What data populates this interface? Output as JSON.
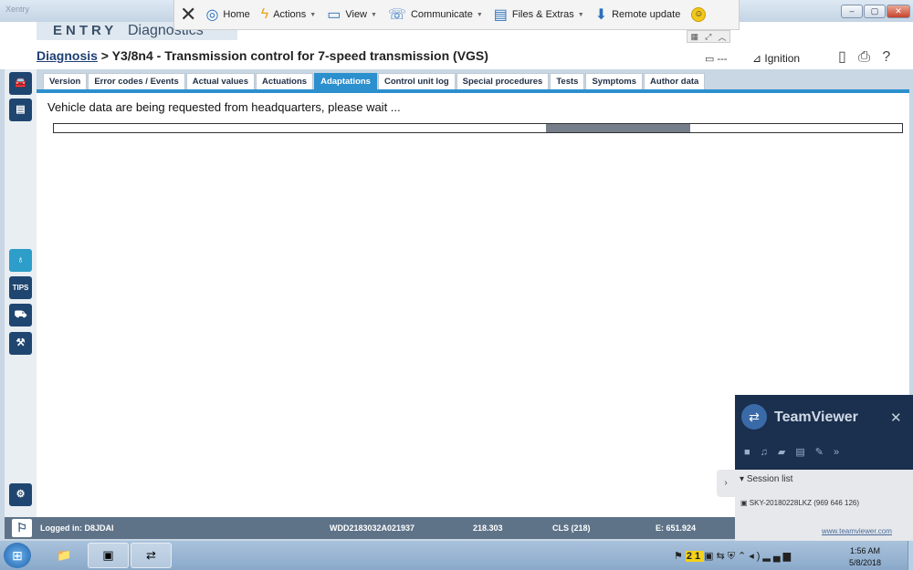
{
  "window": {
    "title": "Xentry"
  },
  "teamviewer_toolbar": {
    "home": "Home",
    "actions": "Actions",
    "view": "View",
    "communicate": "Communicate",
    "files": "Files & Extras",
    "remote_update": "Remote update"
  },
  "header": {
    "brand_entry": "ENTRY",
    "brand_diag": "Diagnostics",
    "breadcrumb_link": "Diagnosis",
    "breadcrumb_rest": " > Y3/8n4 - Transmission control for 7-speed transmission (VGS)",
    "battery": "---",
    "ignition": "Ignition"
  },
  "tabs": [
    {
      "label": "Version",
      "active": false
    },
    {
      "label": "Error codes / Events",
      "active": false
    },
    {
      "label": "Actual values",
      "active": false
    },
    {
      "label": "Actuations",
      "active": false
    },
    {
      "label": "Adaptations",
      "active": true
    },
    {
      "label": "Control unit log",
      "active": false
    },
    {
      "label": "Special procedures",
      "active": false
    },
    {
      "label": "Tests",
      "active": false
    },
    {
      "label": "Symptoms",
      "active": false
    },
    {
      "label": "Author data",
      "active": false
    }
  ],
  "content": {
    "status_message": "Vehicle data are being requested from headquarters, please wait ...",
    "progress_start": 0.58,
    "progress_end": 0.75
  },
  "sidebar": {
    "tips_label": "TIPS"
  },
  "footer": {
    "logged_in": "Logged in: D8JDAI",
    "vin": "WDD2183032A021937",
    "code": "218.303",
    "model": "CLS (218)",
    "engine": "E: 651.924"
  },
  "teamviewer_panel": {
    "name": "TeamViewer",
    "session_list": "Session list",
    "session_item": "SKY-20180228LKZ (969 646 126)",
    "url": "www.teamviewer.com"
  },
  "taskbar": {
    "time": "1:56 AM",
    "date": "5/8/2018",
    "tray_badge": "21"
  }
}
